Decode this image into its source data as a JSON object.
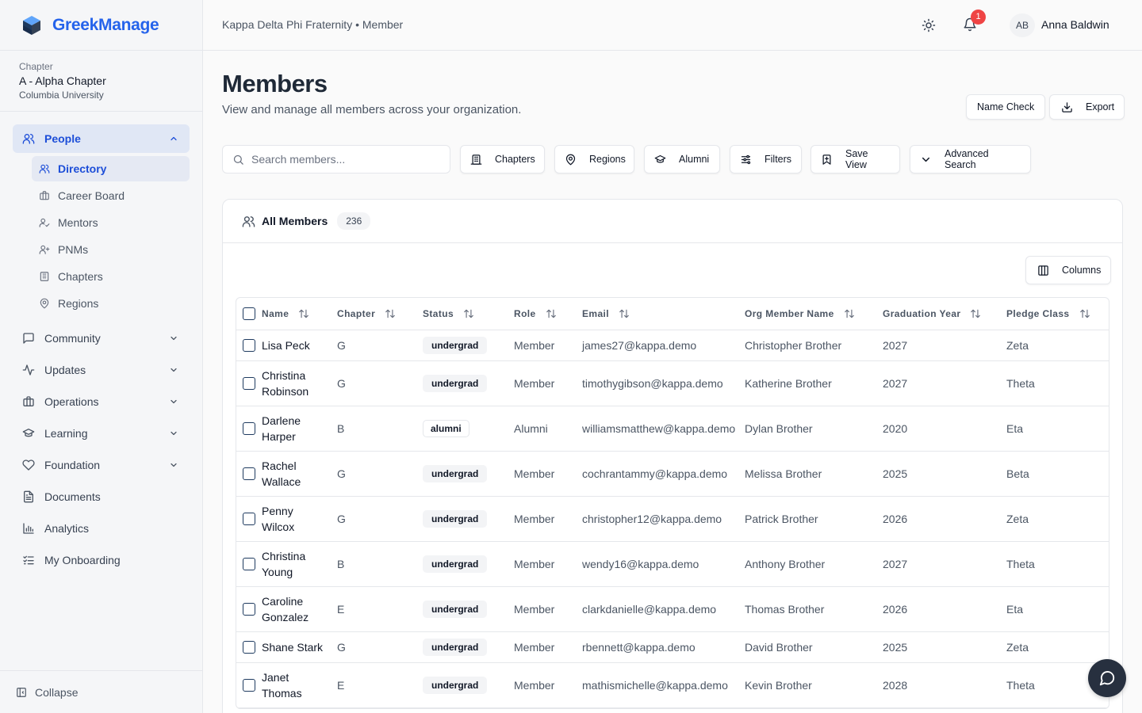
{
  "app": {
    "name": "GreekManage"
  },
  "chapter": {
    "label": "Chapter",
    "name": "A - Alpha Chapter",
    "university": "Columbia University"
  },
  "sidebar": {
    "people": {
      "label": "People",
      "expanded": true
    },
    "people_items": [
      {
        "label": "Directory",
        "icon": "users-icon",
        "active": true
      },
      {
        "label": "Career Board",
        "icon": "briefcase-icon"
      },
      {
        "label": "Mentors",
        "icon": "user-check-icon"
      },
      {
        "label": "PNMs",
        "icon": "user-plus-icon"
      },
      {
        "label": "Chapters",
        "icon": "building-icon"
      },
      {
        "label": "Regions",
        "icon": "map-pin-icon"
      }
    ],
    "groups": [
      {
        "label": "Community",
        "icon": "message-square-icon",
        "has_children": true
      },
      {
        "label": "Updates",
        "icon": "activity-icon",
        "has_children": true
      },
      {
        "label": "Operations",
        "icon": "building-icon",
        "has_children": true
      },
      {
        "label": "Learning",
        "icon": "graduation-cap-icon",
        "has_children": true
      },
      {
        "label": "Foundation",
        "icon": "heart-icon",
        "has_children": true
      },
      {
        "label": "Documents",
        "icon": "file-text-icon",
        "has_children": false
      },
      {
        "label": "Analytics",
        "icon": "bar-chart-icon",
        "has_children": false
      },
      {
        "label": "My Onboarding",
        "icon": "list-checks-icon",
        "has_children": false
      }
    ],
    "collapse_label": "Collapse"
  },
  "header": {
    "breadcrumb": "Kappa Delta Phi Fraternity • Member",
    "notification_count": "1",
    "user_initials": "AB",
    "user_name": "Anna Baldwin"
  },
  "page": {
    "title": "Members",
    "subtitle": "View and manage all members across your organization.",
    "name_check_label": "Name Check",
    "export_label": "Export"
  },
  "toolbar": {
    "search_placeholder": "Search members...",
    "chapters_label": "Chapters",
    "regions_label": "Regions",
    "alumni_label": "Alumni",
    "filters_label": "Filters",
    "save_view_label": "Save View",
    "advanced_search_label": "Advanced Search"
  },
  "members_card": {
    "title": "All Members",
    "count": "236",
    "columns_label": "Columns"
  },
  "table": {
    "headers": [
      "Name",
      "Chapter",
      "Status",
      "Role",
      "Email",
      "Org Member Name",
      "Graduation Year",
      "Pledge Class"
    ],
    "rows": [
      {
        "name": "Lisa Peck",
        "chapter": "G",
        "status": "undergrad",
        "role": "Member",
        "email": "james27@kappa.demo",
        "org_name": "Christopher Brother",
        "grad_year": "2027",
        "pledge": "Zeta"
      },
      {
        "name": "Christina Robinson",
        "chapter": "G",
        "status": "undergrad",
        "role": "Member",
        "email": "timothygibson@kappa.demo",
        "org_name": "Katherine Brother",
        "grad_year": "2027",
        "pledge": "Theta"
      },
      {
        "name": "Darlene Harper",
        "chapter": "B",
        "status": "alumni",
        "role": "Alumni",
        "email": "williamsmatthew@kappa.demo",
        "org_name": "Dylan Brother",
        "grad_year": "2020",
        "pledge": "Eta"
      },
      {
        "name": "Rachel Wallace",
        "chapter": "G",
        "status": "undergrad",
        "role": "Member",
        "email": "cochrantammy@kappa.demo",
        "org_name": "Melissa Brother",
        "grad_year": "2025",
        "pledge": "Beta"
      },
      {
        "name": "Penny Wilcox",
        "chapter": "G",
        "status": "undergrad",
        "role": "Member",
        "email": "christopher12@kappa.demo",
        "org_name": "Patrick Brother",
        "grad_year": "2026",
        "pledge": "Zeta"
      },
      {
        "name": "Christina Young",
        "chapter": "B",
        "status": "undergrad",
        "role": "Member",
        "email": "wendy16@kappa.demo",
        "org_name": "Anthony Brother",
        "grad_year": "2027",
        "pledge": "Theta"
      },
      {
        "name": "Caroline Gonzalez",
        "chapter": "E",
        "status": "undergrad",
        "role": "Member",
        "email": "clarkdanielle@kappa.demo",
        "org_name": "Thomas Brother",
        "grad_year": "2026",
        "pledge": "Eta"
      },
      {
        "name": "Shane Stark",
        "chapter": "G",
        "status": "undergrad",
        "role": "Member",
        "email": "rbennett@kappa.demo",
        "org_name": "David Brother",
        "grad_year": "2025",
        "pledge": "Zeta"
      },
      {
        "name": "Janet Thomas",
        "chapter": "E",
        "status": "undergrad",
        "role": "Member",
        "email": "mathismichelle@kappa.demo",
        "org_name": "Kevin Brother",
        "grad_year": "2028",
        "pledge": "Theta"
      }
    ]
  },
  "colors": {
    "brand": "#2563eb",
    "active_bg": "#e0e7f5",
    "badge": "#ef4444",
    "chat_fab": "#27303f"
  }
}
